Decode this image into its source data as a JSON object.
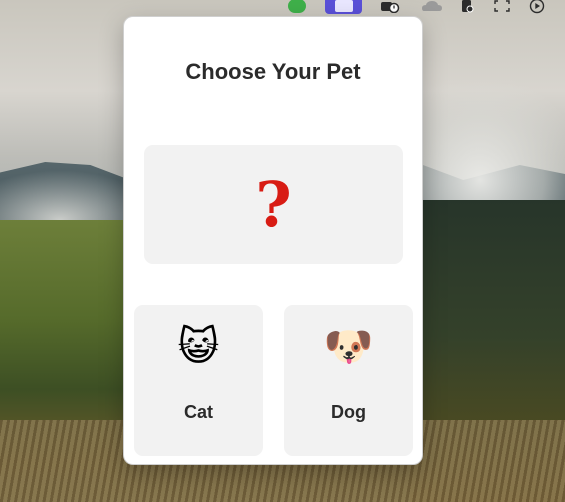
{
  "menubar": {
    "icons": [
      "green-status-icon",
      "active-app-icon",
      "camera-status-icon",
      "cloud-icon",
      "clipboard-icon",
      "screenshot-icon",
      "play-icon"
    ]
  },
  "panel": {
    "title": "Choose Your Pet",
    "result_symbol": "?",
    "choices": [
      {
        "emoji": "😺",
        "label": "Cat"
      },
      {
        "emoji": "🐶",
        "label": "Dog"
      }
    ]
  },
  "colors": {
    "accent": "#5a50d8",
    "question_mark": "#d81c14",
    "card_bg": "#f2f2f2",
    "text": "#2b2b2b"
  }
}
